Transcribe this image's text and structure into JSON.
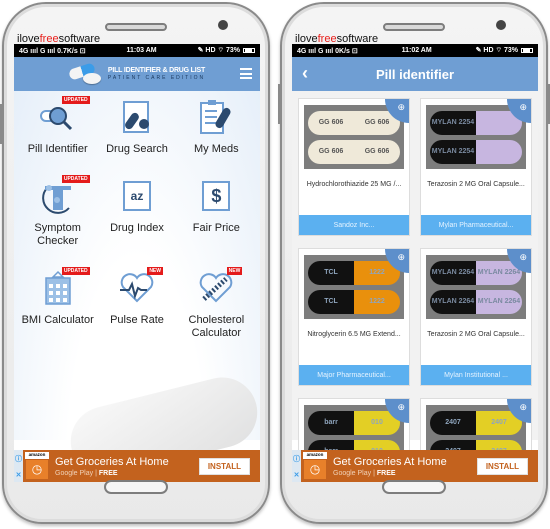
{
  "watermark": {
    "prefix": "ilove",
    "highlight": "free",
    "suffix": "software"
  },
  "left_phone": {
    "status": {
      "left": "4G ıııl G ıııl 0.7K/s ⊡",
      "time": "11:03 AM",
      "right": "✎ HD ⌔ 73%"
    },
    "header": {
      "title_line1": "PILL IDENTIFIER & DRUG LIST",
      "title_line2": "PATIENT CARE EDITION"
    },
    "tiles": [
      {
        "label": "Pill Identifier",
        "badge": "UPDATED",
        "icon": "pill-magnifier-icon"
      },
      {
        "label": "Drug Search",
        "badge": "",
        "icon": "drug-search-icon"
      },
      {
        "label": "My Meds",
        "badge": "",
        "icon": "clipboard-pill-icon"
      },
      {
        "label": "Symptom Checker",
        "badge": "UPDATED",
        "icon": "body-symptom-icon"
      },
      {
        "label": "Drug Index",
        "badge": "",
        "icon_text": "az",
        "icon": "az-index-icon"
      },
      {
        "label": "Fair Price",
        "badge": "",
        "icon_text": "$",
        "icon": "dollar-icon"
      },
      {
        "label": "BMI Calculator",
        "badge": "UPDATED",
        "icon": "calculator-icon"
      },
      {
        "label": "Pulse Rate",
        "badge": "NEW",
        "icon": "heart-pulse-icon"
      },
      {
        "label": "Cholesterol Calculator",
        "badge": "NEW",
        "icon": "heart-artery-icon"
      }
    ]
  },
  "right_phone": {
    "status": {
      "left": "4G ıııl G ıııl 0K/s ⊡",
      "time": "11:02 AM",
      "right": "✎ HD ⌔ 73%"
    },
    "header": {
      "title": "Pill identifier"
    },
    "cards": [
      {
        "name": "Hydrochlorothiazide 25 MG /...",
        "manufacturer": "Sandoz Inc...",
        "imprint_a": "GG 606",
        "imprint_b": "GG 606",
        "color_a": "#efe9d9",
        "color_b": "#efe9d9",
        "text_color": "#555"
      },
      {
        "name": "Terazosin 2 MG Oral Capsule...",
        "manufacturer": "Mylan Pharmaceutical...",
        "imprint_a": "MYLAN 2254",
        "imprint_b": "",
        "color_a": "#111111",
        "color_b": "#c7b6e0",
        "text_color": "#7a8aa0"
      },
      {
        "name": "Nitroglycerin 6.5 MG Extend...",
        "manufacturer": "Major Pharmaceutical...",
        "imprint_a": "TCL",
        "imprint_b": "1222",
        "color_a": "#111111",
        "color_b": "#e9900c",
        "text_color": "#8fa5bd"
      },
      {
        "name": "Terazosin 2 MG Oral Capsule...",
        "manufacturer": "Mylan Institutional ...",
        "imprint_a": "MYLAN 2264",
        "imprint_b": "MYLAN 2264",
        "color_a": "#111111",
        "color_b": "#c7b6e0",
        "text_color": "#7a8aa0"
      },
      {
        "name": "",
        "manufacturer": "",
        "imprint_a": "barr",
        "imprint_b": "010",
        "color_a": "#111111",
        "color_b": "#e3cf25",
        "text_color": "#8fa5bd"
      },
      {
        "name": "",
        "manufacturer": "",
        "imprint_a": "2407",
        "imprint_b": "2407",
        "color_a": "#111111",
        "color_b": "#e3cf25",
        "text_color": "#8fa5bd"
      }
    ]
  },
  "ad": {
    "brand": "amazon",
    "headline": "Get Groceries At Home",
    "store": "Google Play",
    "separator": "|",
    "price": "FREE",
    "install_label": "INSTALL",
    "info_icon": "ⓘ",
    "close_icon": "✕"
  },
  "colors": {
    "appbar": "#6f9ed3",
    "ad": "#c3621e",
    "manufacturer_bar": "#5bb0f0",
    "badge": "#e41b1b"
  }
}
